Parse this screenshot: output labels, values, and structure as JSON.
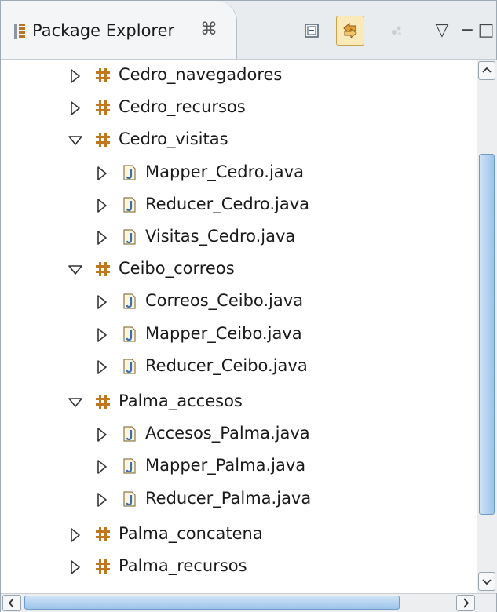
{
  "view": {
    "title": "Package Explorer",
    "close_glyph": "⌘",
    "icon": "package-explorer-icon",
    "toolbar": [
      {
        "name": "collapse-all-button",
        "icon": "collapse-all-icon",
        "active": false
      },
      {
        "name": "link-with-editor-button",
        "icon": "link-with-editor-icon",
        "active": true
      },
      {
        "name": "filter-button",
        "icon": "filter-icon",
        "active": false
      },
      {
        "name": "view-menu-button",
        "icon": "view-menu-icon",
        "glyph": "▽",
        "active": false
      },
      {
        "name": "minimize-button",
        "icon": "minimize-icon",
        "glyph": "−",
        "active": false
      },
      {
        "name": "maximize-button",
        "icon": "maximize-icon",
        "glyph": "□",
        "active": false
      }
    ]
  },
  "tree": {
    "items": [
      {
        "label": "Cedro_navegadores",
        "type": "package",
        "level": 0,
        "expanded": false
      },
      {
        "label": "Cedro_recursos",
        "type": "package",
        "level": 0,
        "expanded": false
      },
      {
        "label": "Cedro_visitas",
        "type": "package",
        "level": 0,
        "expanded": true
      },
      {
        "label": "Mapper_Cedro.java",
        "type": "java-file",
        "level": 1,
        "expanded": false
      },
      {
        "label": "Reducer_Cedro.java",
        "type": "java-file",
        "level": 1,
        "expanded": false
      },
      {
        "label": "Visitas_Cedro.java",
        "type": "java-file",
        "level": 1,
        "expanded": false
      },
      {
        "label": "Ceibo_correos",
        "type": "package",
        "level": 0,
        "expanded": true
      },
      {
        "label": "Correos_Ceibo.java",
        "type": "java-file",
        "level": 1,
        "expanded": false
      },
      {
        "label": "Mapper_Ceibo.java",
        "type": "java-file",
        "level": 1,
        "expanded": false
      },
      {
        "label": "Reducer_Ceibo.java",
        "type": "java-file",
        "level": 1,
        "expanded": false
      },
      {
        "label": "Palma_accesos",
        "type": "package",
        "level": 0,
        "expanded": true
      },
      {
        "label": "Accesos_Palma.java",
        "type": "java-file",
        "level": 1,
        "expanded": false
      },
      {
        "label": "Mapper_Palma.java",
        "type": "java-file",
        "level": 1,
        "expanded": false
      },
      {
        "label": "Reducer_Palma.java",
        "type": "java-file",
        "level": 1,
        "expanded": false
      },
      {
        "label": "Palma_concatena",
        "type": "package",
        "level": 0,
        "expanded": false
      },
      {
        "label": "Palma_recursos",
        "type": "package",
        "level": 0,
        "expanded": false
      }
    ]
  },
  "colors": {
    "package_icon": "#c0781c",
    "java_file_icon": "#3a6fb0",
    "scrollbar_thumb": "#9cc4ea",
    "active_toolbar": "#fbeab9"
  }
}
